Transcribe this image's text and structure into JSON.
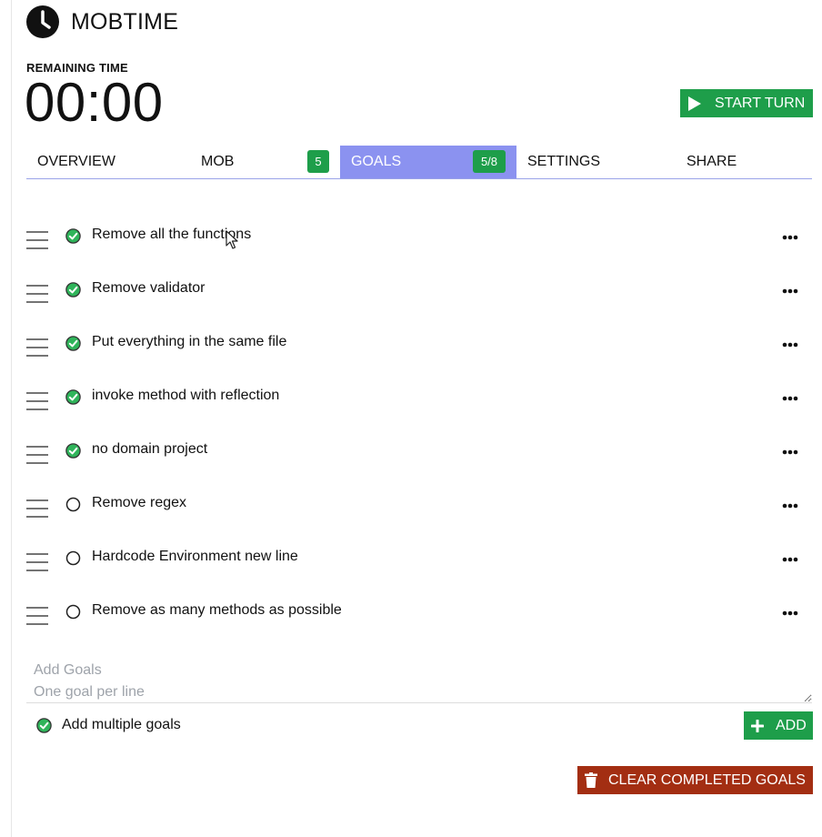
{
  "app": {
    "title": "MOBTIME"
  },
  "timer": {
    "label": "REMAINING TIME",
    "value": "00:00"
  },
  "start_button": {
    "label": "START TURN"
  },
  "tabs": [
    {
      "label": "OVERVIEW",
      "badge": ""
    },
    {
      "label": "MOB",
      "badge": "5"
    },
    {
      "label": "GOALS",
      "badge": "5/8",
      "active": true
    },
    {
      "label": "SETTINGS",
      "badge": ""
    },
    {
      "label": "SHARE",
      "badge": ""
    }
  ],
  "goals": [
    {
      "text": "Remove all the functions",
      "completed": true
    },
    {
      "text": "Remove validator",
      "completed": true
    },
    {
      "text": "Put everything in the same file",
      "completed": true
    },
    {
      "text": "invoke method with reflection",
      "completed": true
    },
    {
      "text": "no domain project",
      "completed": true
    },
    {
      "text": "Remove regex",
      "completed": false
    },
    {
      "text": "Hardcode Environment new line",
      "completed": false
    },
    {
      "text": "Remove as many methods as possible",
      "completed": false
    }
  ],
  "add_goals": {
    "placeholder": "Add Goals\nOne goal per line",
    "value": ""
  },
  "multiple_goals": {
    "label": "Add multiple goals",
    "checked": true
  },
  "add_button": {
    "label": "ADD"
  },
  "clear_button": {
    "label": "CLEAR COMPLETED GOALS"
  },
  "colors": {
    "accent_green": "#1e9e4a",
    "tab_active": "#8b92f0",
    "danger": "#a32e12"
  },
  "icons": {
    "logo": "clock-icon",
    "start": "play-icon",
    "handle": "drag-handle-icon",
    "done": "check-circle-icon",
    "todo": "circle-icon",
    "menu": "more-icon",
    "add": "plus-icon",
    "clear": "trash-icon"
  }
}
